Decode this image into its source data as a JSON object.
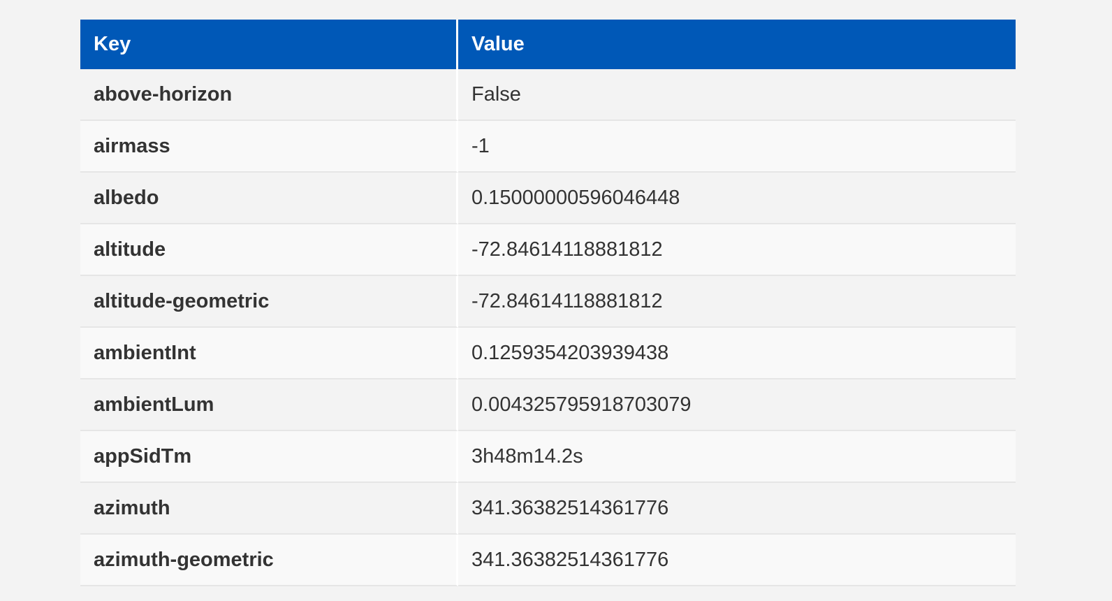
{
  "table": {
    "headers": {
      "key": "Key",
      "value": "Value"
    },
    "rows": [
      {
        "key": "above-horizon",
        "value": "False"
      },
      {
        "key": "airmass",
        "value": "-1"
      },
      {
        "key": "albedo",
        "value": "0.15000000596046448"
      },
      {
        "key": "altitude",
        "value": "-72.84614118881812"
      },
      {
        "key": "altitude-geometric",
        "value": "-72.84614118881812"
      },
      {
        "key": "ambientInt",
        "value": "0.1259354203939438"
      },
      {
        "key": "ambientLum",
        "value": "0.004325795918703079"
      },
      {
        "key": "appSidTm",
        "value": "3h48m14.2s"
      },
      {
        "key": "azimuth",
        "value": "341.36382514361776"
      },
      {
        "key": "azimuth-geometric",
        "value": "341.36382514361776"
      }
    ]
  },
  "colors": {
    "header_background": "#0058b7",
    "header_text": "#ffffff",
    "row_odd": "#f3f3f3",
    "row_even": "#f9f9f9"
  }
}
